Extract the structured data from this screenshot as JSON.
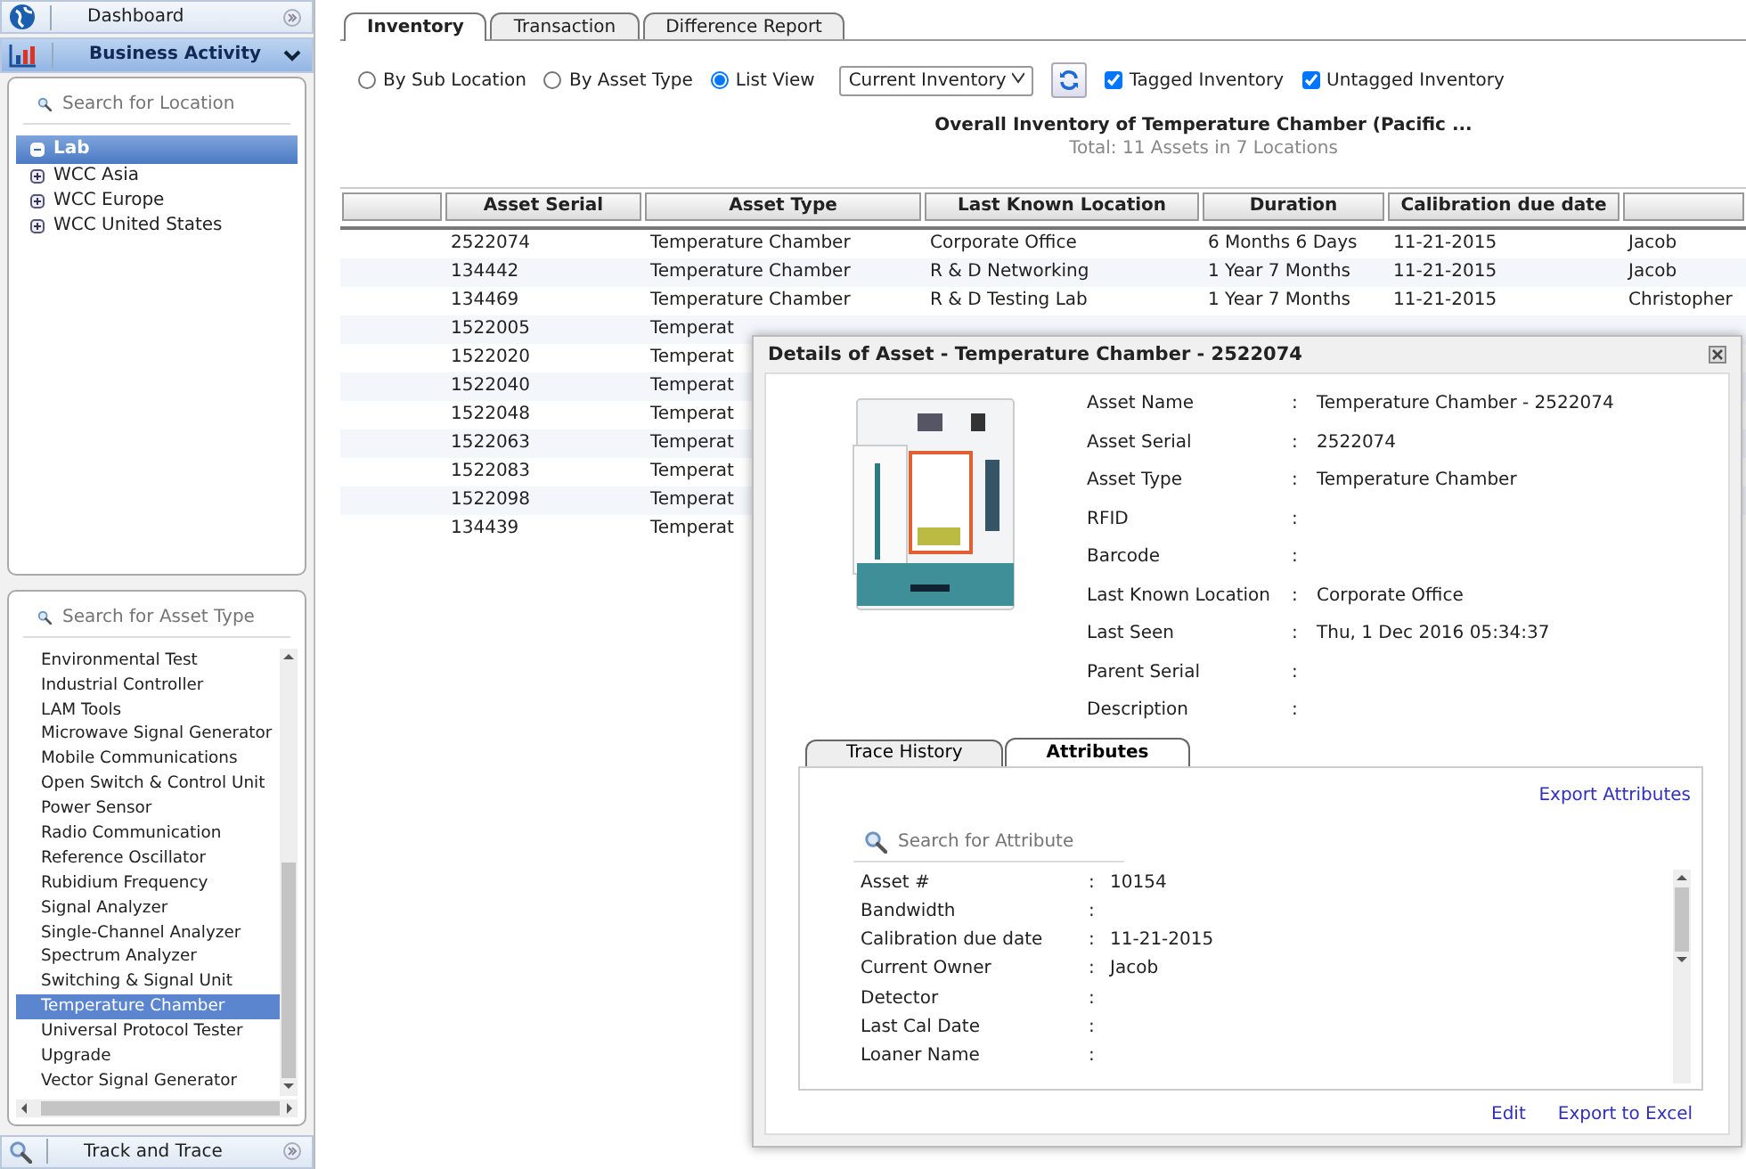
{
  "sidebar": {
    "nav": [
      {
        "label": "Dashboard",
        "kind": "globe",
        "selected": false
      },
      {
        "label": "Business Activity",
        "kind": "chart",
        "selected": true
      }
    ],
    "location_search": {
      "placeholder": "Search for Location"
    },
    "locations": [
      {
        "label": "Lab",
        "expanded": true,
        "selected": true,
        "children": [
          {
            "label": "WCC Asia",
            "expanded": false,
            "selected": false
          },
          {
            "label": "WCC Europe",
            "expanded": false,
            "selected": false
          },
          {
            "label": "WCC United States",
            "expanded": false,
            "selected": false
          }
        ]
      }
    ],
    "asset_type_search": {
      "placeholder": "Search for Asset Type"
    },
    "asset_types": [
      {
        "label": "Environmental Test",
        "selected": false
      },
      {
        "label": "Industrial Controller",
        "selected": false
      },
      {
        "label": "LAM Tools",
        "selected": false
      },
      {
        "label": "Microwave Signal Generator",
        "selected": false
      },
      {
        "label": "Mobile Communications",
        "selected": false
      },
      {
        "label": "Open Switch & Control Unit",
        "selected": false
      },
      {
        "label": "Power Sensor",
        "selected": false
      },
      {
        "label": "Radio Communication",
        "selected": false
      },
      {
        "label": "Reference Oscillator",
        "selected": false
      },
      {
        "label": "Rubidium Frequency",
        "selected": false
      },
      {
        "label": "Signal Analyzer",
        "selected": false
      },
      {
        "label": "Single-Channel Analyzer",
        "selected": false
      },
      {
        "label": "Spectrum Analyzer",
        "selected": false
      },
      {
        "label": "Switching & Signal Unit",
        "selected": false
      },
      {
        "label": "Temperature Chamber",
        "selected": true
      },
      {
        "label": "Universal Protocol Tester",
        "selected": false
      },
      {
        "label": "Upgrade",
        "selected": false
      },
      {
        "label": "Vector Signal Generator",
        "selected": false
      }
    ],
    "footer_nav": {
      "label": "Track and Trace"
    }
  },
  "tabs": [
    {
      "label": "Inventory",
      "selected": true
    },
    {
      "label": "Transaction",
      "selected": false
    },
    {
      "label": "Difference Report",
      "selected": false
    }
  ],
  "view_options": [
    {
      "label": "By Sub Location",
      "selected": false
    },
    {
      "label": "By Asset Type",
      "selected": false
    },
    {
      "label": "List View",
      "selected": true
    }
  ],
  "inventory_select": {
    "value": "Current Inventory"
  },
  "filters": [
    {
      "label": "Tagged Inventory",
      "checked": true
    },
    {
      "label": "Untagged Inventory",
      "checked": true
    }
  ],
  "summary": {
    "title": "Overall Inventory of Temperature Chamber (Pacific ...",
    "subtitle": "Total: 11 Assets in 7 Locations"
  },
  "table": {
    "columns": [
      "Asset Serial",
      "Asset Type",
      "Last Known Location",
      "Duration",
      "Calibration due date"
    ],
    "rows": [
      {
        "cells": [
          "2522074",
          "Temperature Chamber",
          "Corporate Office",
          "6 Months 6 Days",
          "11-21-2015",
          "Jacob"
        ]
      },
      {
        "cells": [
          "134442",
          "Temperature Chamber",
          "R & D Networking",
          "1 Year 7 Months",
          "11-21-2015",
          "Jacob"
        ]
      },
      {
        "cells": [
          "134469",
          "Temperature Chamber",
          "R & D Testing Lab",
          "1 Year 7 Months",
          "11-21-2015",
          "Christopher"
        ]
      },
      {
        "cells": [
          "1522005",
          "Temperat"
        ]
      },
      {
        "cells": [
          "1522020",
          "Temperat"
        ]
      },
      {
        "cells": [
          "1522040",
          "Temperat"
        ]
      },
      {
        "cells": [
          "1522048",
          "Temperat"
        ]
      },
      {
        "cells": [
          "1522063",
          "Temperat"
        ]
      },
      {
        "cells": [
          "1522083",
          "Temperat"
        ]
      },
      {
        "cells": [
          "1522098",
          "Temperat"
        ]
      },
      {
        "cells": [
          "134439",
          "Temperat"
        ]
      }
    ]
  },
  "dialog": {
    "title": "Details of Asset - Temperature Chamber - 2522074",
    "fields": [
      {
        "label": "Asset Name",
        "separator": ":",
        "value": "Temperature Chamber - 2522074"
      },
      {
        "label": "Asset Serial",
        "separator": ":",
        "value": "2522074"
      },
      {
        "label": "Asset Type",
        "separator": ":",
        "value": "Temperature Chamber"
      },
      {
        "label": "RFID",
        "separator": ":"
      },
      {
        "label": "Barcode",
        "separator": ":"
      },
      {
        "label": "Last Known Location",
        "separator": ":",
        "value": "Corporate Office"
      },
      {
        "label": "Last Seen",
        "separator": ":",
        "value": "Thu, 1 Dec 2016 05:34:37"
      },
      {
        "label": "Parent Serial",
        "separator": ":"
      },
      {
        "label": "Description",
        "separator": ":"
      }
    ],
    "tabs": [
      {
        "label": "Trace History",
        "selected": false
      },
      {
        "label": "Attributes",
        "selected": true
      }
    ],
    "export_link": "Export Attributes",
    "attribute_search": {
      "placeholder": "Search for Attribute"
    },
    "attributes": [
      {
        "label": "Asset #",
        "separator": ":",
        "value": "10154"
      },
      {
        "label": "Bandwidth",
        "separator": ":"
      },
      {
        "label": "Calibration due date",
        "separator": ":",
        "value": "11-21-2015"
      },
      {
        "label": "Current Owner",
        "separator": ":",
        "value": "Jacob"
      },
      {
        "label": "Detector",
        "separator": ":"
      },
      {
        "label": "Last Cal Date",
        "separator": ":"
      },
      {
        "label": "Loaner Name",
        "separator": ":"
      }
    ],
    "actions": [
      "Edit",
      "Export to Excel"
    ]
  }
}
